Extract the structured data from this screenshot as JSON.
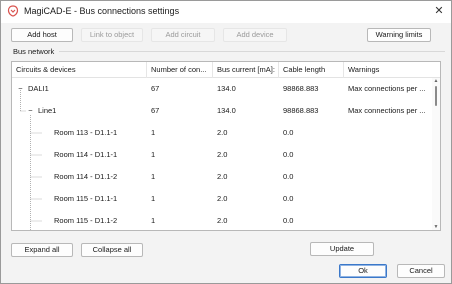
{
  "window": {
    "title": "MagiCAD-E - Bus connections settings",
    "close_glyph": "✕"
  },
  "toolbar": {
    "add_host": "Add host",
    "link_to_object": "Link to object",
    "add_circuit": "Add circuit",
    "add_device": "Add device",
    "warning_limits": "Warning limits"
  },
  "group": {
    "label": "Bus network"
  },
  "table": {
    "columns": [
      "Circuits & devices",
      "Number of con...",
      "Bus current [mA]:",
      "Cable length",
      "Warnings"
    ],
    "rows": [
      {
        "name": "DALI1",
        "connections": "67",
        "current": "134.0",
        "length": "98868.883",
        "warnings": "Max connections per ...",
        "expander": "−"
      },
      {
        "name": "Line1",
        "connections": "67",
        "current": "134.0",
        "length": "98868.883",
        "warnings": "Max connections per ...",
        "expander": "−"
      },
      {
        "name": "Room 113 - D1.1-1",
        "connections": "1",
        "current": "2.0",
        "length": "0.0",
        "warnings": ""
      },
      {
        "name": "Room 114 - D1.1-1",
        "connections": "1",
        "current": "2.0",
        "length": "0.0",
        "warnings": ""
      },
      {
        "name": "Room 114 - D1.1-2",
        "connections": "1",
        "current": "2.0",
        "length": "0.0",
        "warnings": ""
      },
      {
        "name": "Room 115 - D1.1-1",
        "connections": "1",
        "current": "2.0",
        "length": "0.0",
        "warnings": ""
      },
      {
        "name": "Room 115 - D1.1-2",
        "connections": "1",
        "current": "2.0",
        "length": "0.0",
        "warnings": ""
      }
    ]
  },
  "footer": {
    "expand_all": "Expand all",
    "collapse_all": "Collapse all",
    "update": "Update",
    "ok": "Ok",
    "cancel": "Cancel"
  },
  "icons": {
    "app": "magicad-logo-icon",
    "close": "close-icon",
    "scroll_up": "scroll-up-arrow-icon",
    "scroll_down": "scroll-down-arrow-icon"
  },
  "colors": {
    "accent": "#3b78c9",
    "logo": "#d9534f",
    "disabled_text": "#9a9a9a"
  }
}
